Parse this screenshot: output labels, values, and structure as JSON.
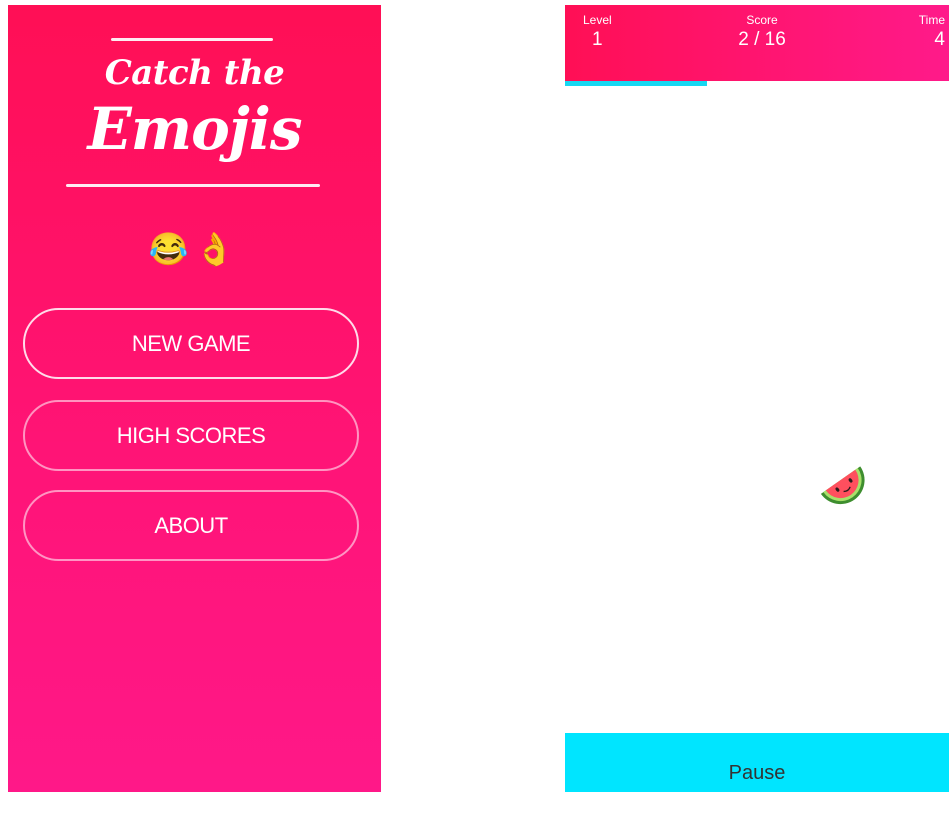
{
  "menu": {
    "logo": {
      "line1": "Catch the",
      "line2": "Emojis"
    },
    "emojis": "😂👌",
    "buttons": [
      {
        "label": "NEW GAME"
      },
      {
        "label": "HIGH SCORES"
      },
      {
        "label": "ABOUT"
      }
    ],
    "colors": {
      "gradient_top": "#ff0f55",
      "gradient_bottom": "#ff1888"
    }
  },
  "game": {
    "level_label": "Level",
    "level_value": "1",
    "score_label": "Score",
    "score_value": "2 / 16",
    "time_label": "Time",
    "time_value": "4",
    "progress_fraction": 0.37,
    "falling_emoji": "watermelon-icon",
    "pause_label": "Pause",
    "colors": {
      "header": "#ff0f55",
      "accent": "#00e5ff"
    }
  }
}
